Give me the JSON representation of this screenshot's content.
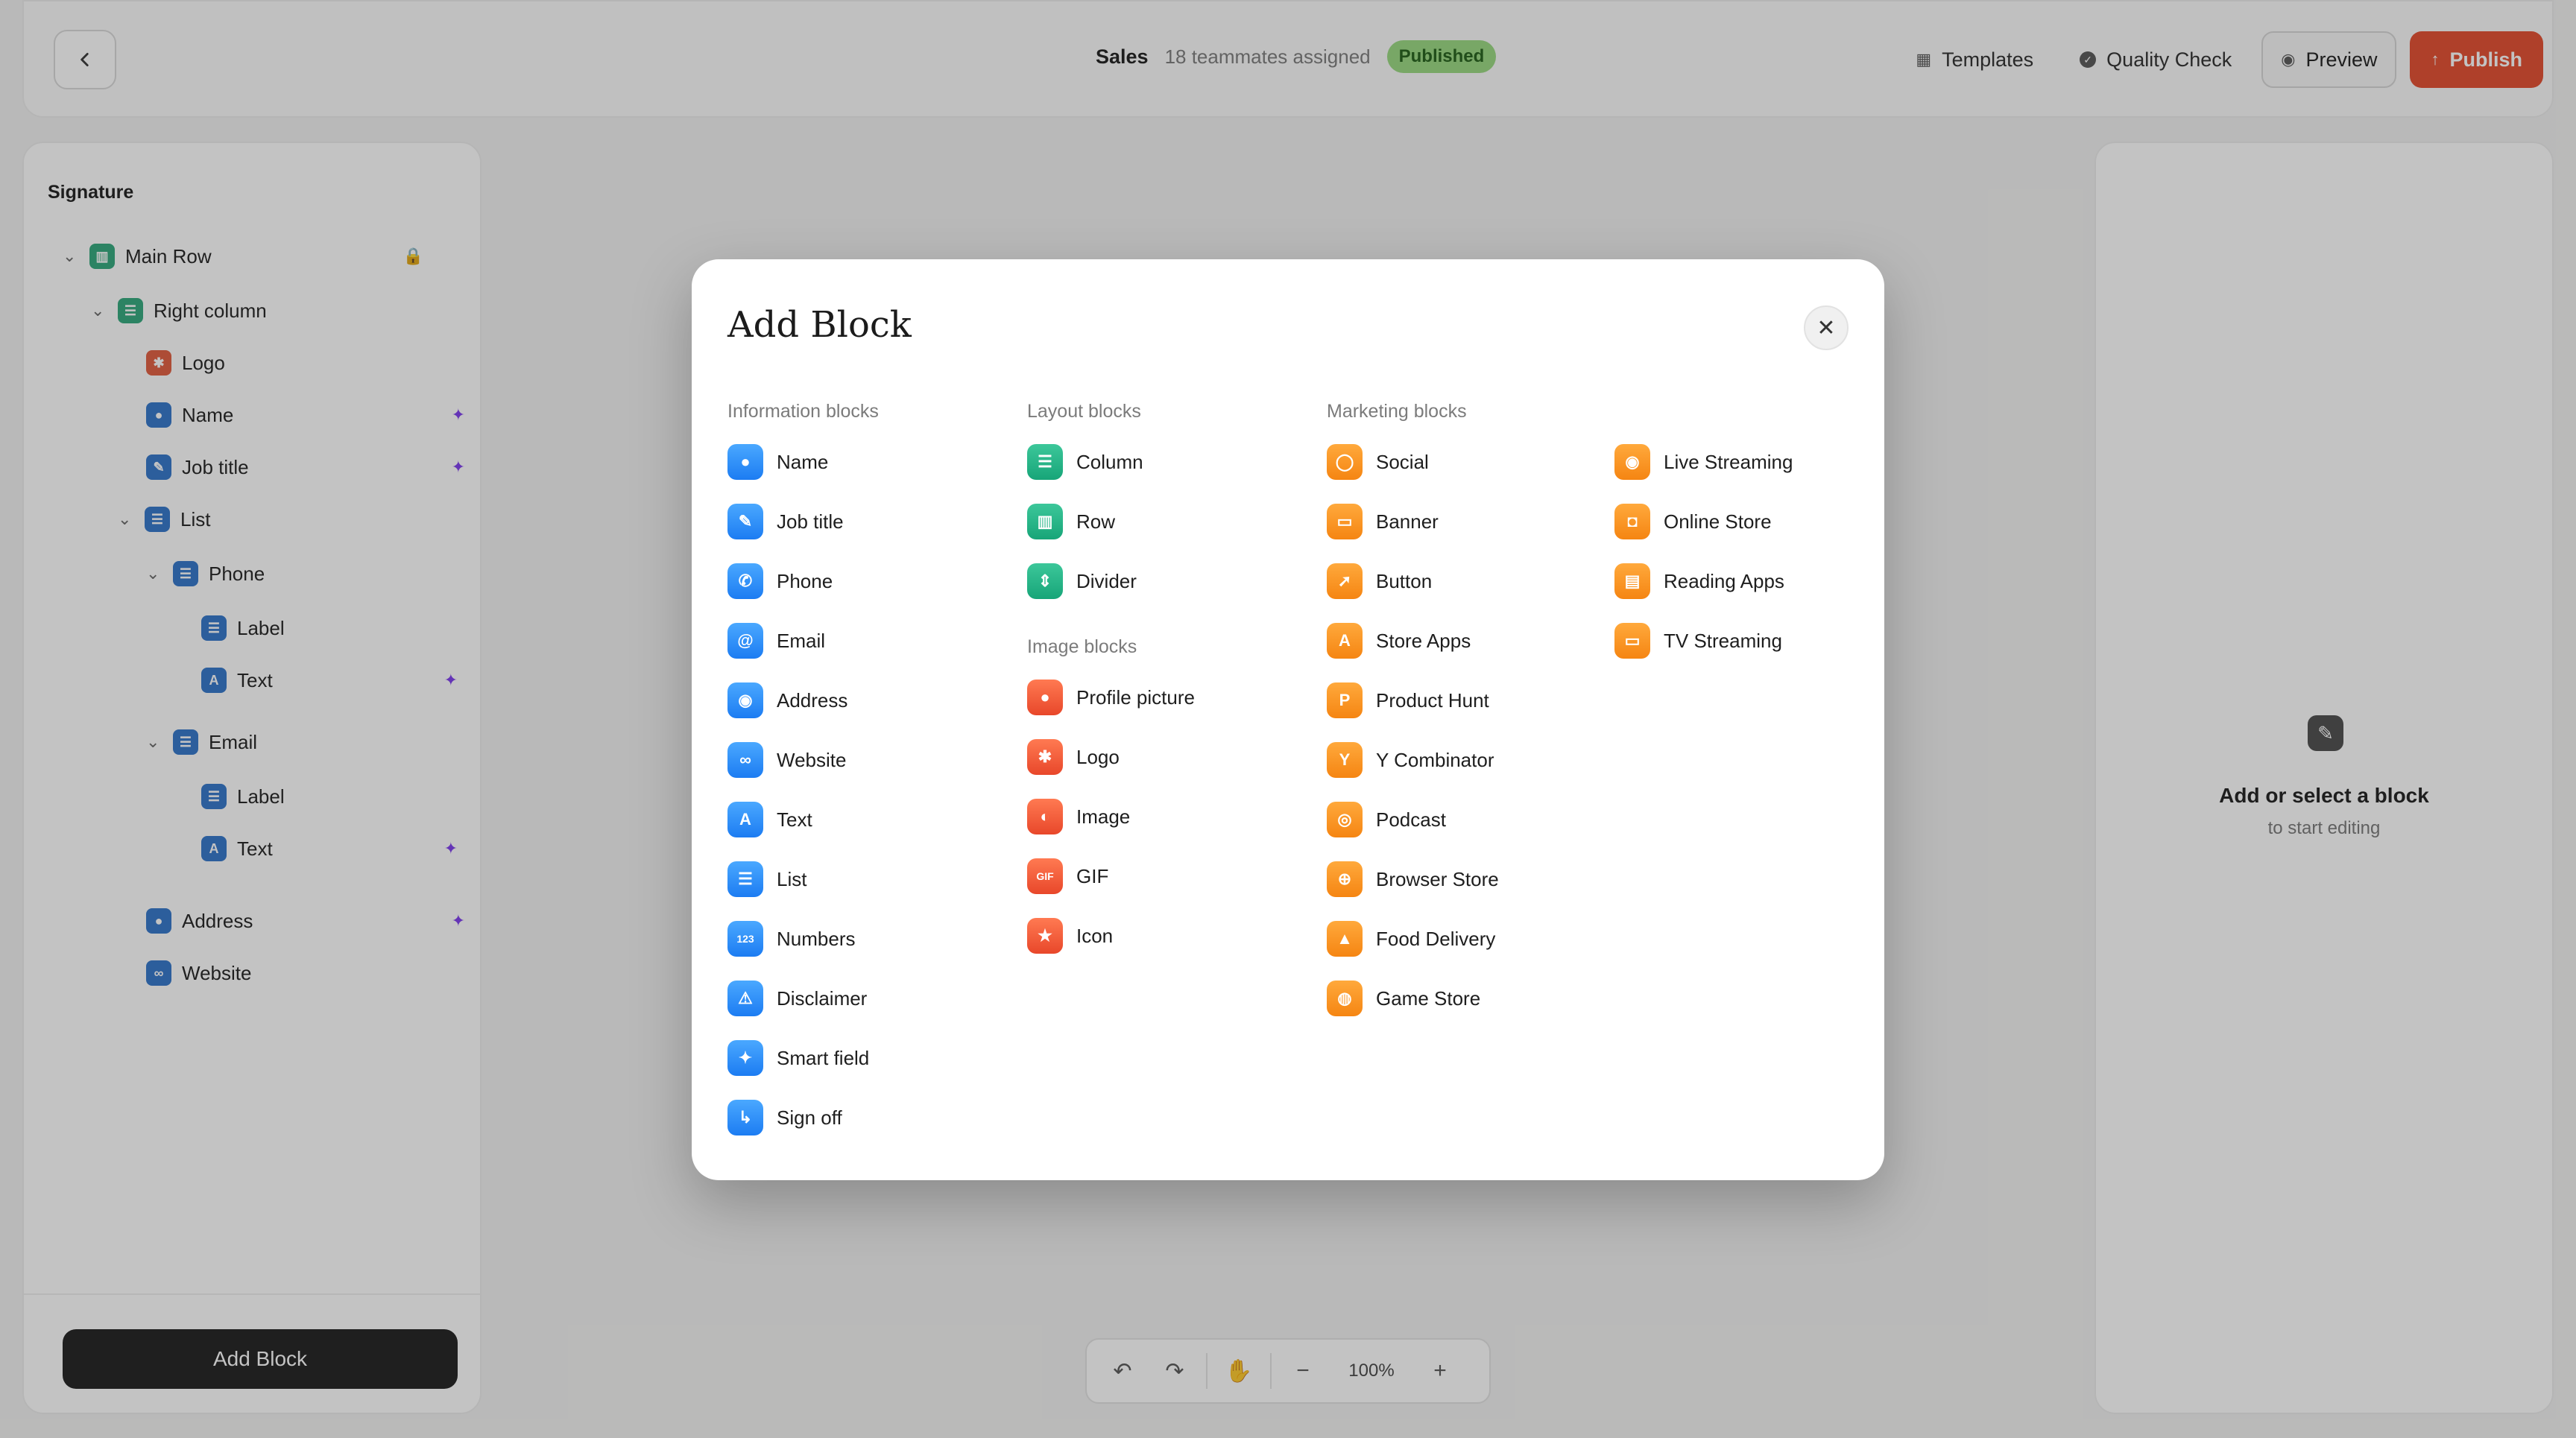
{
  "topbar": {
    "title": "Sales",
    "subtitle": "18 teammates assigned",
    "status": "Published",
    "templates": "Templates",
    "quality_check": "Quality Check",
    "preview": "Preview",
    "publish": "Publish"
  },
  "left": {
    "title": "Signature",
    "tree": [
      {
        "label": "Main Row"
      },
      {
        "label": "Right column"
      },
      {
        "label": "Logo"
      },
      {
        "label": "Name"
      },
      {
        "label": "Job title"
      },
      {
        "label": "List"
      },
      {
        "label": "Phone"
      },
      {
        "label": "Label"
      },
      {
        "label": "Text"
      },
      {
        "label": "Email"
      },
      {
        "label": "Label"
      },
      {
        "label": "Text"
      },
      {
        "label": "Address"
      },
      {
        "label": "Website"
      }
    ],
    "add_block": "Add Block"
  },
  "right": {
    "title": "Add or select a block",
    "subtitle": "to start editing"
  },
  "zoom": {
    "level": "100%"
  },
  "modal": {
    "title": "Add Block",
    "information": {
      "heading": "Information blocks",
      "items": [
        "Name",
        "Job title",
        "Phone",
        "Email",
        "Address",
        "Website",
        "Text",
        "List",
        "Numbers",
        "Disclaimer",
        "Smart field",
        "Sign off"
      ]
    },
    "layout": {
      "heading": "Layout blocks",
      "items": [
        "Column",
        "Row",
        "Divider"
      ]
    },
    "image": {
      "heading": "Image blocks",
      "items": [
        "Profile picture",
        "Logo",
        "Image",
        "GIF",
        "Icon"
      ]
    },
    "marketing": {
      "heading": "Marketing blocks",
      "items": [
        "Social",
        "Banner",
        "Button",
        "Store Apps",
        "Product Hunt",
        "Y Combinator",
        "Podcast",
        "Browser Store",
        "Food Delivery",
        "Game Store"
      ],
      "items2": [
        "Live Streaming",
        "Online Store",
        "Reading Apps",
        "TV Streaming"
      ]
    }
  },
  "colors": {
    "publish": "#e34a2c",
    "published_badge": "#97d87f",
    "info_icon": "#1c7cf2",
    "layout_icon": "#17a578",
    "image_icon": "#e8472a",
    "marketing_icon": "#f58512"
  }
}
